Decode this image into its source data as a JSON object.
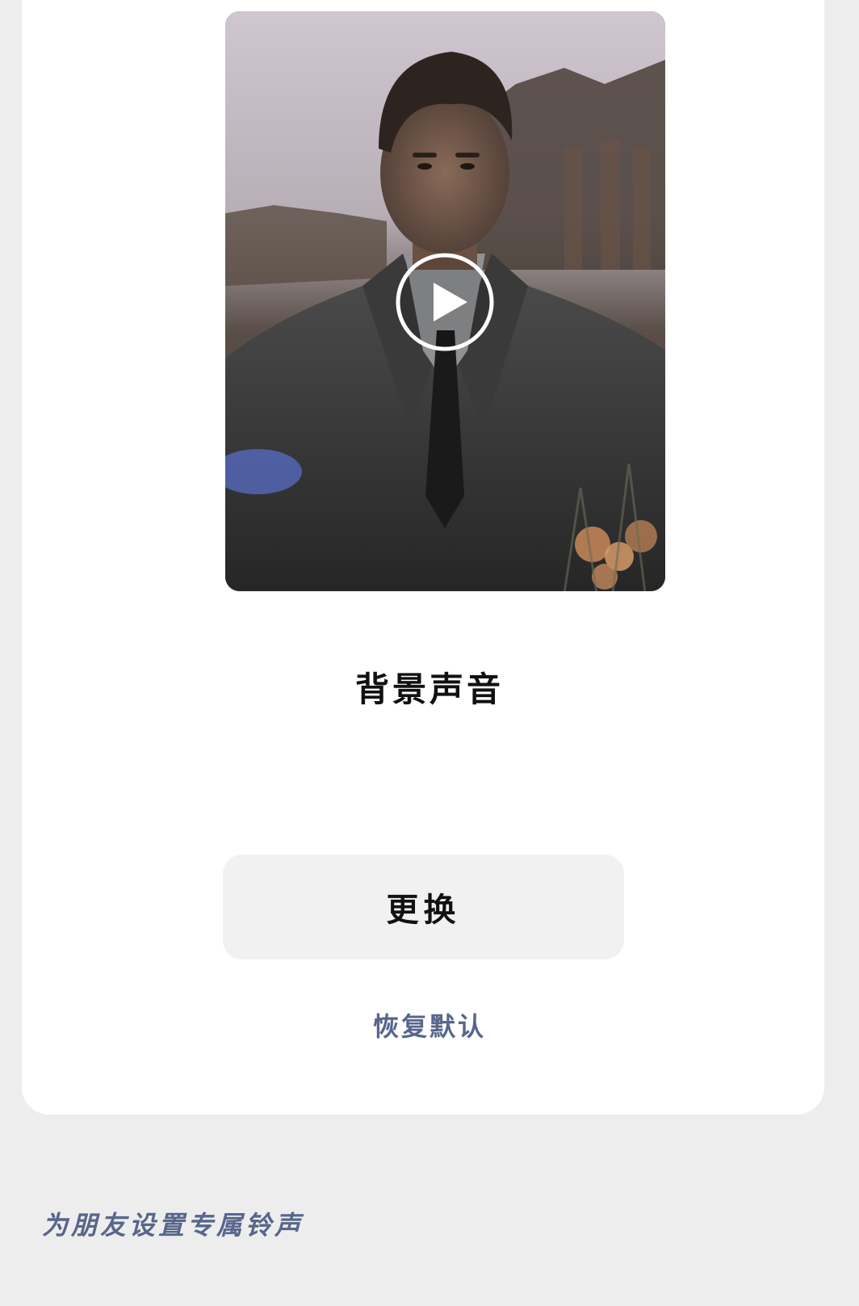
{
  "preview": {
    "image_alt": "background-video-preview",
    "play_icon": "play-circle-icon"
  },
  "title": "背景声音",
  "actions": {
    "replace_label": "更换",
    "restore_label": "恢复默认"
  },
  "section": {
    "friends_ringtone_label": "为朋友设置专属铃声"
  },
  "colors": {
    "page_background": "#ededed",
    "card_background": "#ffffff",
    "button_background": "#f1f1f1",
    "link_color": "#57668b",
    "text_color": "#111111"
  }
}
